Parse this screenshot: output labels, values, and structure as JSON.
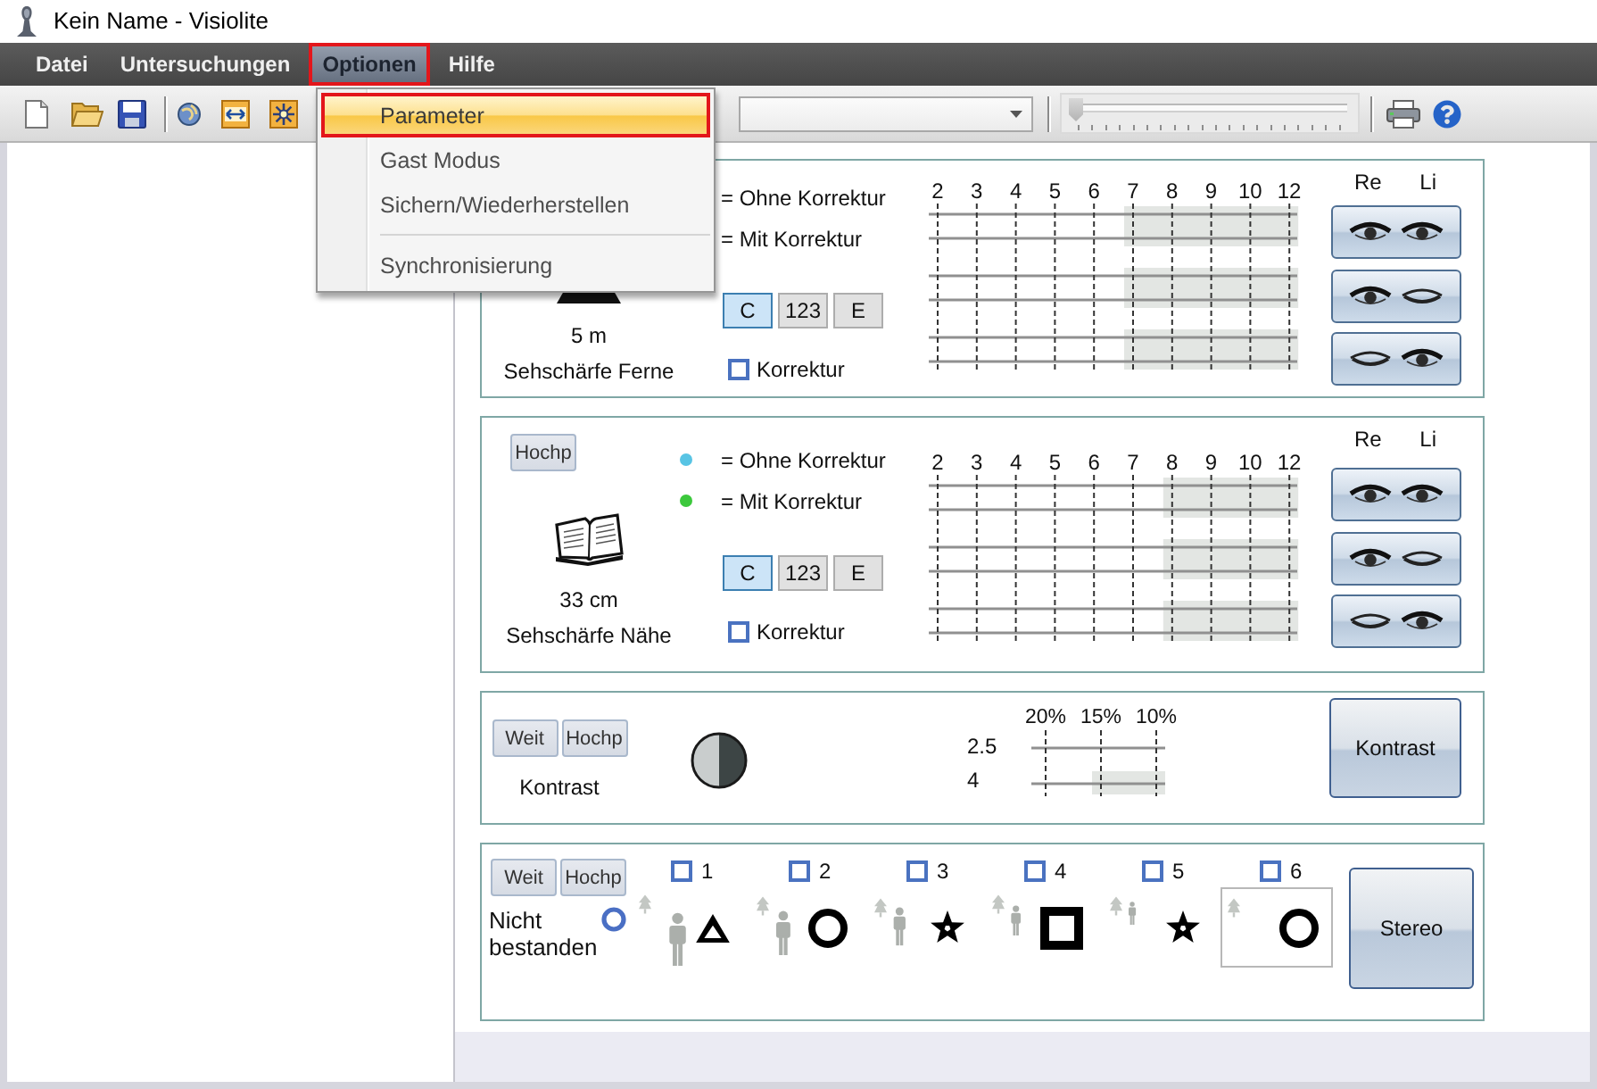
{
  "window": {
    "title": "Kein Name - Visiolite"
  },
  "menu_bar": [
    {
      "label": "Datei",
      "selected": false
    },
    {
      "label": "Untersuchungen",
      "selected": false
    },
    {
      "label": "Optionen",
      "selected": true
    },
    {
      "label": "Hilfe",
      "selected": false
    }
  ],
  "toolbar": {
    "slider": {
      "level": 0
    }
  },
  "dropdown_menu": [
    {
      "kind": "item",
      "label": "Parameter",
      "selected": true
    },
    {
      "kind": "item",
      "label": "Gast Modus",
      "selected": false
    },
    {
      "kind": "item",
      "label": "Sichern/Wiederherstellen",
      "selected": false
    },
    {
      "kind": "separator"
    },
    {
      "kind": "item",
      "label": "Synchronisierung",
      "selected": false
    }
  ],
  "acuity_panels": [
    {
      "kind": "far",
      "distance": "5 m",
      "title": "Sehschärfe Ferne",
      "legend": [
        {
          "label": "= Ohne Korrektur"
        },
        {
          "label": "= Mit Korrektur"
        }
      ],
      "optotype_buttons": [
        {
          "label": "C",
          "selected": true
        },
        {
          "label": "123",
          "selected": false
        },
        {
          "label": "E",
          "selected": false
        }
      ],
      "correction": {
        "label": "Korrektur",
        "checked": false
      },
      "grid_columns": [
        {
          "label": "2",
          "shaded": false
        },
        {
          "label": "3",
          "shaded": false
        },
        {
          "label": "4",
          "shaded": false
        },
        {
          "label": "5",
          "shaded": false
        },
        {
          "label": "6",
          "shaded": false
        },
        {
          "label": "7",
          "shaded": true
        },
        {
          "label": "8",
          "shaded": true
        },
        {
          "label": "9",
          "shaded": true
        },
        {
          "label": "10",
          "shaded": true
        },
        {
          "label": "12",
          "shaded": true
        }
      ],
      "eye_labels": [
        "Re",
        "Li"
      ],
      "eye_buttons": [
        {
          "right_eye_open": true,
          "left_eye_open": true
        },
        {
          "right_eye_open": true,
          "left_eye_open": false
        },
        {
          "right_eye_open": false,
          "left_eye_open": true
        }
      ]
    },
    {
      "kind": "near",
      "view_buttons": [
        {
          "label": "Hochp"
        }
      ],
      "distance": "33 cm",
      "title": "Sehschärfe Nähe",
      "legend": [
        {
          "label": "= Ohne Korrektur",
          "color": "#58c4e4"
        },
        {
          "label": "= Mit Korrektur",
          "color": "#3cc83c"
        }
      ],
      "optotype_buttons": [
        {
          "label": "C",
          "selected": true
        },
        {
          "label": "123",
          "selected": false
        },
        {
          "label": "E",
          "selected": false
        }
      ],
      "correction": {
        "label": "Korrektur",
        "checked": false
      },
      "grid_columns": [
        {
          "label": "2",
          "shaded": false
        },
        {
          "label": "3",
          "shaded": false
        },
        {
          "label": "4",
          "shaded": false
        },
        {
          "label": "5",
          "shaded": false
        },
        {
          "label": "6",
          "shaded": false
        },
        {
          "label": "7",
          "shaded": false
        },
        {
          "label": "8",
          "shaded": true
        },
        {
          "label": "9",
          "shaded": true
        },
        {
          "label": "10",
          "shaded": true
        },
        {
          "label": "12",
          "shaded": true
        }
      ],
      "eye_labels": [
        "Re",
        "Li"
      ],
      "eye_buttons": [
        {
          "right_eye_open": true,
          "left_eye_open": true
        },
        {
          "right_eye_open": true,
          "left_eye_open": false
        },
        {
          "right_eye_open": false,
          "left_eye_open": true
        }
      ]
    }
  ],
  "contrast_panel": {
    "view_buttons": [
      {
        "label": "Weit"
      },
      {
        "label": "Hochp"
      }
    ],
    "title": "Kontrast",
    "grid": {
      "columns": [
        "20%",
        "15%",
        "10%"
      ],
      "rows": [
        {
          "label": "2.5",
          "shaded": [
            false,
            false,
            false
          ]
        },
        {
          "label": "4",
          "shaded": [
            false,
            true,
            true
          ]
        }
      ]
    },
    "button": "Kontrast"
  },
  "stereo_panel": {
    "view_buttons": [
      {
        "label": "Weit"
      },
      {
        "label": "Hochp"
      }
    ],
    "status": "Nicht bestanden",
    "items": [
      {
        "label": "1",
        "checked": false,
        "kind": "triangle",
        "person": true,
        "framed": false
      },
      {
        "label": "2",
        "checked": false,
        "kind": "circle",
        "person": true,
        "framed": false
      },
      {
        "label": "3",
        "checked": false,
        "kind": "star",
        "person": true,
        "framed": false
      },
      {
        "label": "4",
        "checked": false,
        "kind": "square",
        "person": true,
        "framed": false
      },
      {
        "label": "5",
        "checked": false,
        "kind": "star",
        "person": true,
        "framed": false
      },
      {
        "label": "6",
        "checked": false,
        "kind": "circle",
        "person": false,
        "framed": true
      }
    ],
    "button": "Stereo"
  }
}
